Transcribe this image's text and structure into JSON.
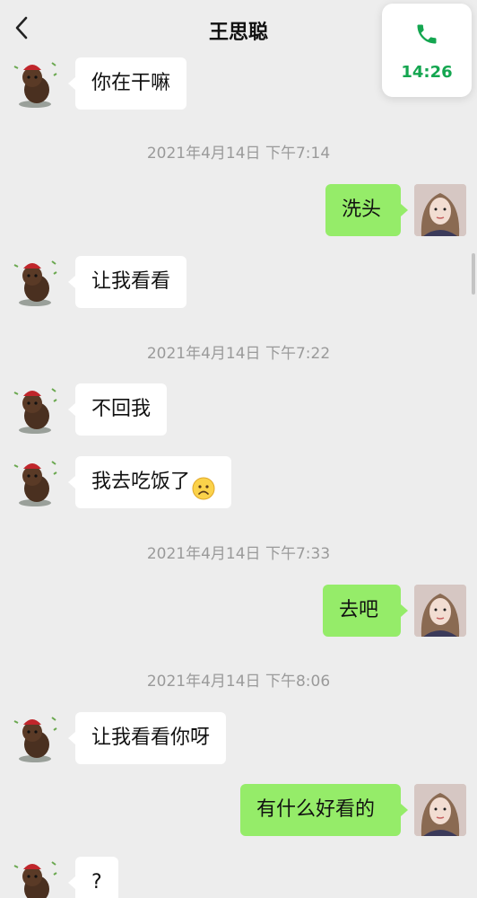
{
  "header": {
    "title": "王思聪"
  },
  "call": {
    "time": "14:26"
  },
  "messages": [
    {
      "text": "你在干嘛"
    },
    {
      "text": "洗头"
    },
    {
      "text": "让我看看"
    },
    {
      "text": "不回我"
    },
    {
      "text": "我去吃饭了"
    },
    {
      "text": "去吧"
    },
    {
      "text": "让我看看你呀"
    },
    {
      "text": "有什么好看的"
    },
    {
      "text": "?"
    }
  ],
  "timestamps": [
    "2021年4月14日 下午7:14",
    "2021年4月14日 下午7:22",
    "2021年4月14日 下午7:33",
    "2021年4月14日 下午8:06"
  ],
  "colors": {
    "sent_bubble": "#95ec69",
    "received_bubble": "#ffffff",
    "call_time": "#14a650",
    "background": "#ededed"
  }
}
